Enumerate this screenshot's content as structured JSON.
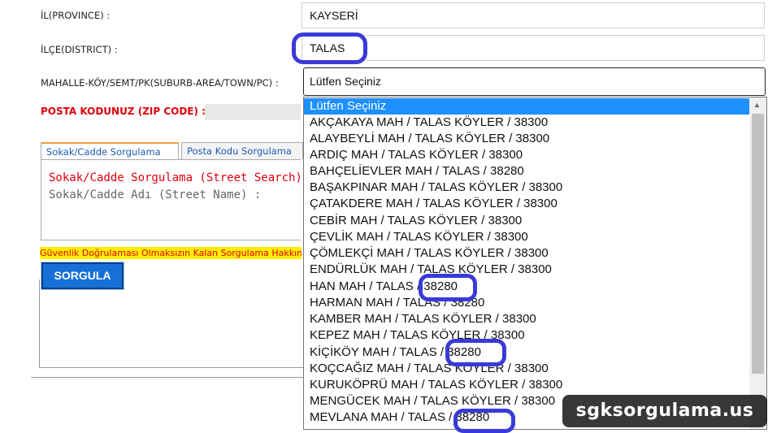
{
  "form": {
    "province_label": "İL(PROVINCE) :",
    "province_value": "KAYSERİ",
    "district_label": "İLÇE(DISTRICT) :",
    "district_value": "TALAS",
    "neighborhood_label": "MAHALLE-KÖY/SEMT/PK(SUBURB-AREA/TOWN/PC) :",
    "neighborhood_selected": "Lütfen Seçiniz",
    "zip_label": "POSTA KODUNUZ (ZIP CODE) :"
  },
  "tabs": [
    {
      "label": "Sokak/Cadde Sorgulama",
      "active": true
    },
    {
      "label": "Posta Kodu Sorgulama",
      "active": false
    }
  ],
  "street_search": {
    "title": "Sokak/Cadde Sorgulama (Street Search)",
    "street_name_label": "Sokak/Cadde Adı (Street Name) :"
  },
  "warning_text": "Güvenlik Doğrulaması Olmaksızın Kalan Sorgulama Hakkınız",
  "submit_button": "SORGULA",
  "dropdown": {
    "options": [
      "Lütfen Seçiniz",
      "AKÇAKAYA MAH / TALAS KÖYLER / 38300",
      "ALAYBEYLİ MAH / TALAS KÖYLER / 38300",
      "ARDIÇ MAH / TALAS KÖYLER / 38300",
      "BAHÇELİEVLER MAH / TALAS / 38280",
      "BAŞAKPINAR MAH / TALAS KÖYLER / 38300",
      "ÇATAKDERE MAH / TALAS KÖYLER / 38300",
      "CEBİR MAH / TALAS KÖYLER / 38300",
      "ÇEVLİK MAH / TALAS KÖYLER / 38300",
      "ÇÖMLEKÇİ MAH / TALAS KÖYLER / 38300",
      "ENDÜRLÜK MAH / TALAS KÖYLER / 38300",
      "HAN MAH / TALAS / 38280",
      "HARMAN MAH / TALAS / 38280",
      "KAMBER MAH / TALAS KÖYLER / 38300",
      "KEPEZ MAH / TALAS KÖYLER / 38300",
      "KİÇİKÖY MAH / TALAS / 38280",
      "KOÇCAĞIZ MAH / TALAS KÖYLER / 38300",
      "KURUKÖPRÜ MAH / TALAS KÖYLER / 38300",
      "MENGÜCEK MAH / TALAS KÖYLER / 38300",
      "MEVLANA MAH / TALAS / 38280"
    ],
    "selected_index": 0
  },
  "watermark": "sgksorgulama.us",
  "colors": {
    "highlight_circle": "#3a3ad8",
    "selected_option": "#1e90ff",
    "button": "#1670d6",
    "warning_bg": "#ffee00",
    "zip_label": "#e0000b"
  }
}
